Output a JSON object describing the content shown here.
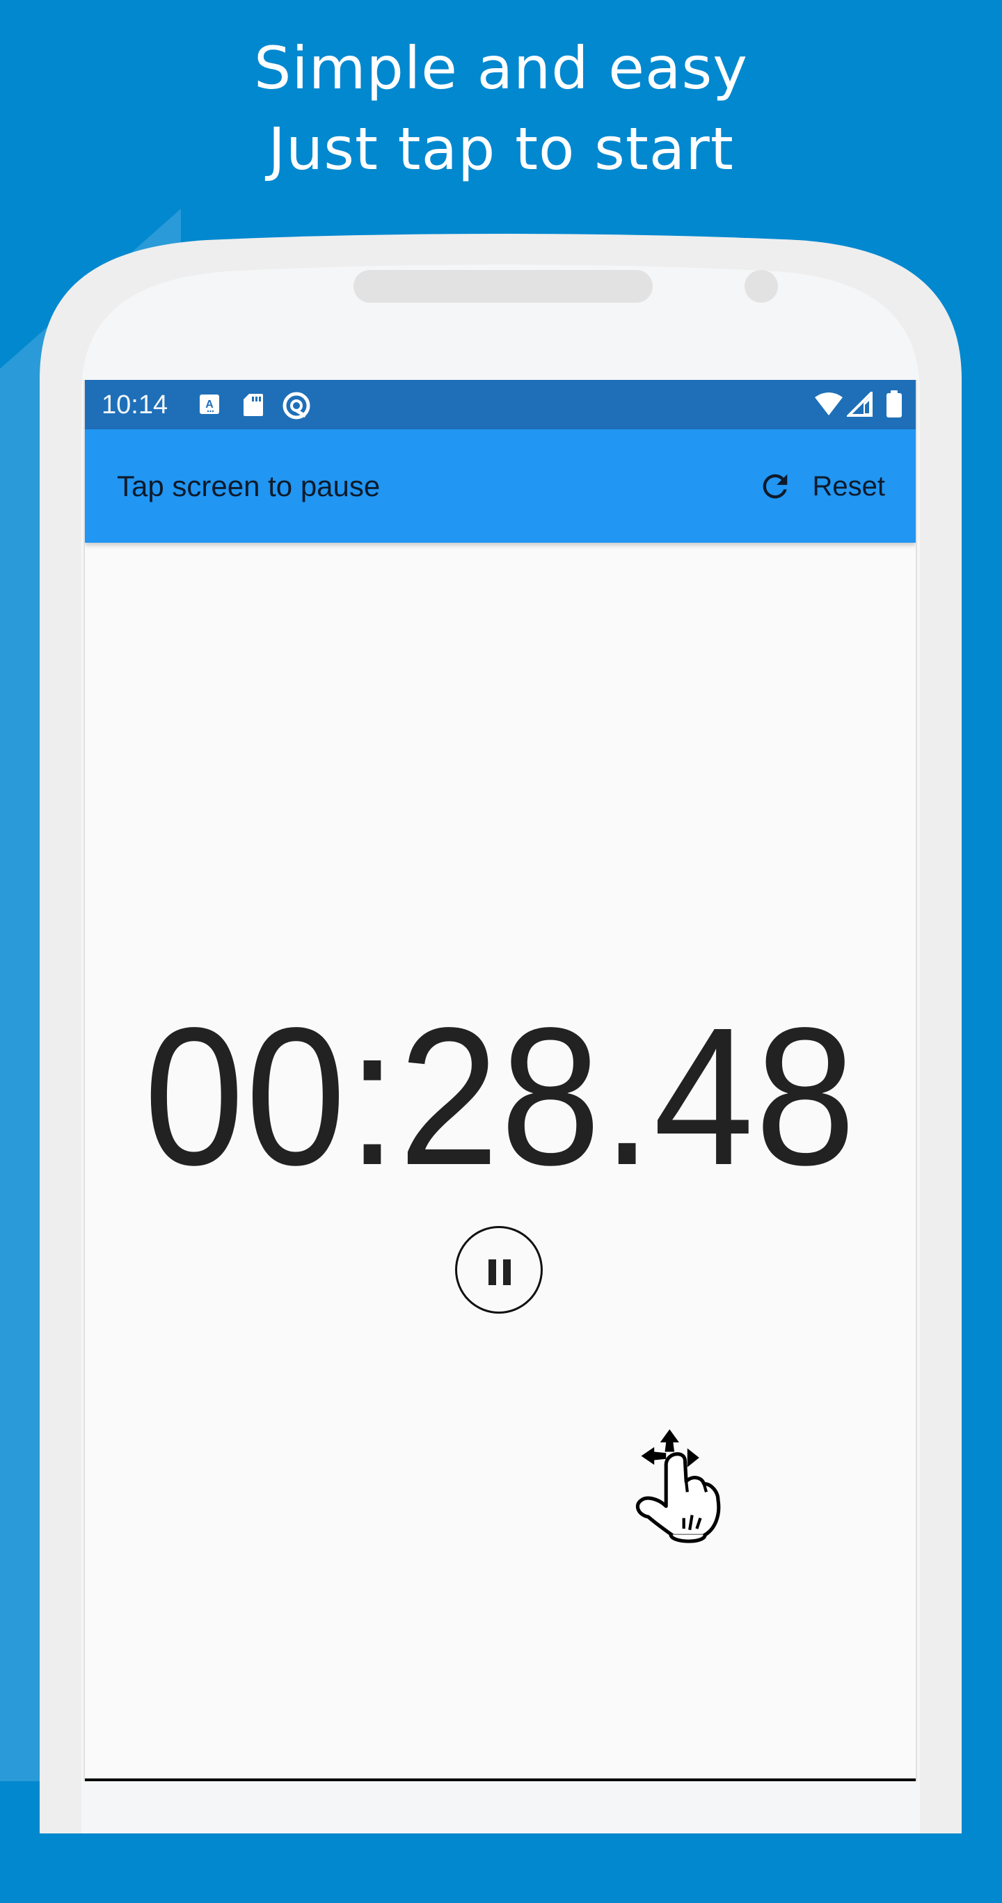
{
  "promo": {
    "line1": "Simple and easy",
    "line2": "Just tap to start"
  },
  "colors": {
    "background": "#0288CF",
    "status_bar": "#1E6FB8",
    "app_bar": "#2196F3",
    "screen": "#FAFAFA",
    "timer_text": "#222222"
  },
  "status_bar": {
    "time": "10:14",
    "left_icons": [
      "font-accessibility-icon",
      "sd-card-icon",
      "android-q-icon"
    ],
    "right_icons": [
      "wifi-icon",
      "cell-signal-icon",
      "battery-icon"
    ]
  },
  "app_bar": {
    "title": "Tap screen to pause",
    "reset_label": "Reset",
    "reset_icon": "refresh-icon"
  },
  "stopwatch": {
    "elapsed": "00:28.48",
    "control_icon": "pause-icon",
    "hint_icon": "tap-gesture-hand-icon"
  }
}
